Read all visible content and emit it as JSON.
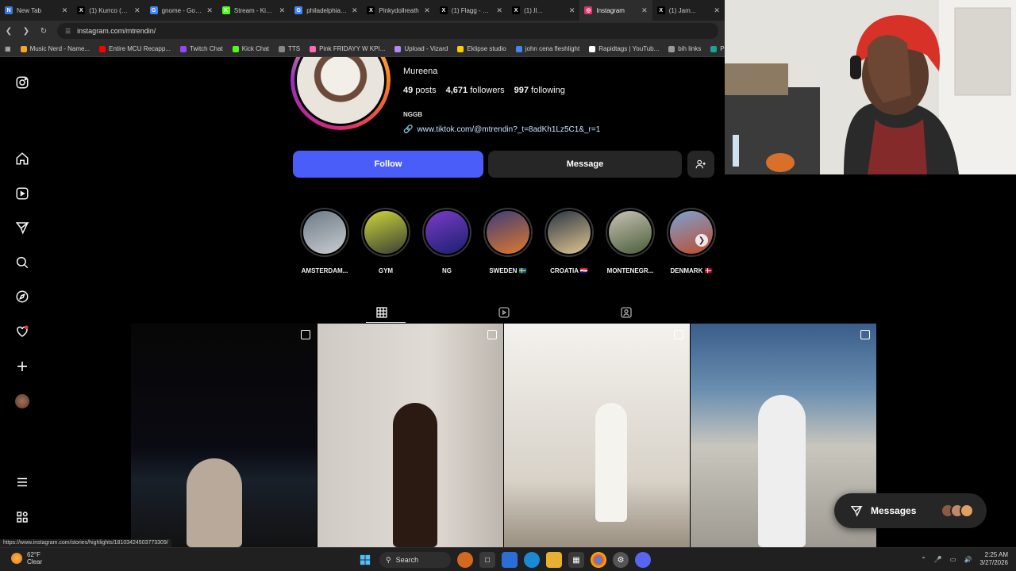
{
  "browser": {
    "tabs": [
      {
        "label": "New Tab",
        "color": "#3c78d8",
        "glyph": "N"
      },
      {
        "label": "(1) Kurrco (@K...",
        "color": "#000000",
        "glyph": "X"
      },
      {
        "label": "gnome - Goog...",
        "color": "#4285f4",
        "glyph": "G"
      },
      {
        "label": "Stream - Kick D...",
        "color": "#53fc18",
        "glyph": "K"
      },
      {
        "label": "philadelphia b...",
        "color": "#4285f4",
        "glyph": "G"
      },
      {
        "label": "Pinkydollreath",
        "color": "#000000",
        "glyph": "X"
      },
      {
        "label": "(1) Flagg - Sea...",
        "color": "#000000",
        "glyph": "X"
      },
      {
        "label": "(1) ﻿ﺍﻟ...",
        "color": "#000000",
        "glyph": "X"
      },
      {
        "label": "Instagram",
        "color": "#e1306c",
        "glyph": "◎"
      },
      {
        "label": "(1) Jam...",
        "color": "#000000",
        "glyph": "X"
      }
    ],
    "active_tab_index": 8,
    "url": "instagram.com/mtrendin/",
    "bookmarks": [
      {
        "label": "Music Nerd - Name...",
        "color": "#f5a623"
      },
      {
        "label": "Entire MCU Recapp...",
        "color": "#ff0000"
      },
      {
        "label": "Twitch Chat",
        "color": "#9146ff"
      },
      {
        "label": "Kick Chat",
        "color": "#53fc18"
      },
      {
        "label": "TTS",
        "color": "#888888"
      },
      {
        "label": "Pink FRIDAYY W KPI...",
        "color": "#ff69b4"
      },
      {
        "label": "Upload - Vizard",
        "color": "#b388ff"
      },
      {
        "label": "Eklipse studio",
        "color": "#ffcc00"
      },
      {
        "label": "john cena fleshlight",
        "color": "#4285f4"
      },
      {
        "label": "Rapidtags | YouTub...",
        "color": "#ffffff"
      },
      {
        "label": "bih links",
        "color": "#999999"
      },
      {
        "label": "Photopea",
        "color": "#18a497"
      }
    ]
  },
  "profile": {
    "name": "Mureena",
    "posts_count": "49",
    "posts_label": "posts",
    "followers_count": "4,671",
    "followers_label": "followers",
    "following_count": "997",
    "following_label": "following",
    "bio": "NGGB",
    "link": "www.tiktok.com/@mtrendin?_t=8adKh1Lz5C1&_r=1",
    "follow_label": "Follow",
    "message_label": "Message"
  },
  "highlights": [
    {
      "label": "AMSTERDAM...",
      "colors": [
        "#6b7a86",
        "#c9ccd0"
      ]
    },
    {
      "label": "GYM",
      "colors": [
        "#cdd63a",
        "#3a3f35"
      ]
    },
    {
      "label": "NG",
      "colors": [
        "#7a3cc8",
        "#1c1f6e"
      ]
    },
    {
      "label": "SWEDEN 🇸🇪",
      "colors": [
        "#3c3c7a",
        "#e07a2c"
      ]
    },
    {
      "label": "CROATIA 🇭🇷",
      "colors": [
        "#2b3545",
        "#e0c690"
      ]
    },
    {
      "label": "MONTENEGR...",
      "colors": [
        "#c8c2b4",
        "#4a5e3a"
      ]
    },
    {
      "label": "DENMARK 🇩🇰",
      "colors": [
        "#7aa3d4",
        "#c04a2c"
      ]
    }
  ],
  "posts": [
    {
      "bg": "linear-gradient(180deg,#070707 0%,#0a0a12 55%,#18202a 70%,#121212 100%)",
      "figure": "#b8a99a"
    },
    {
      "bg": "linear-gradient(90deg,#cfcac4 0%,#e0dbd4 60%,#bcb6ae 100%)",
      "figure": "#2b1a12"
    },
    {
      "bg": "linear-gradient(180deg,#f4f2ee 0%,#d8d2c8 70%,#9a8f80 100%)",
      "figure": "#f5f3ee"
    },
    {
      "bg": "linear-gradient(180deg,#3a5d8a 0%,#6a8fb0 30%,#c9c6be 55%,#9e9a92 100%)",
      "figure": "#eeeeee"
    }
  ],
  "messages": {
    "label": "Messages"
  },
  "status_bar_url": "https://www.instagram.com/stories/highlights/18103424503773309/",
  "taskbar": {
    "temperature": "62°F",
    "condition": "Clear",
    "search_label": "Search",
    "time": "2:25 AM",
    "date": "3/27/2026"
  }
}
